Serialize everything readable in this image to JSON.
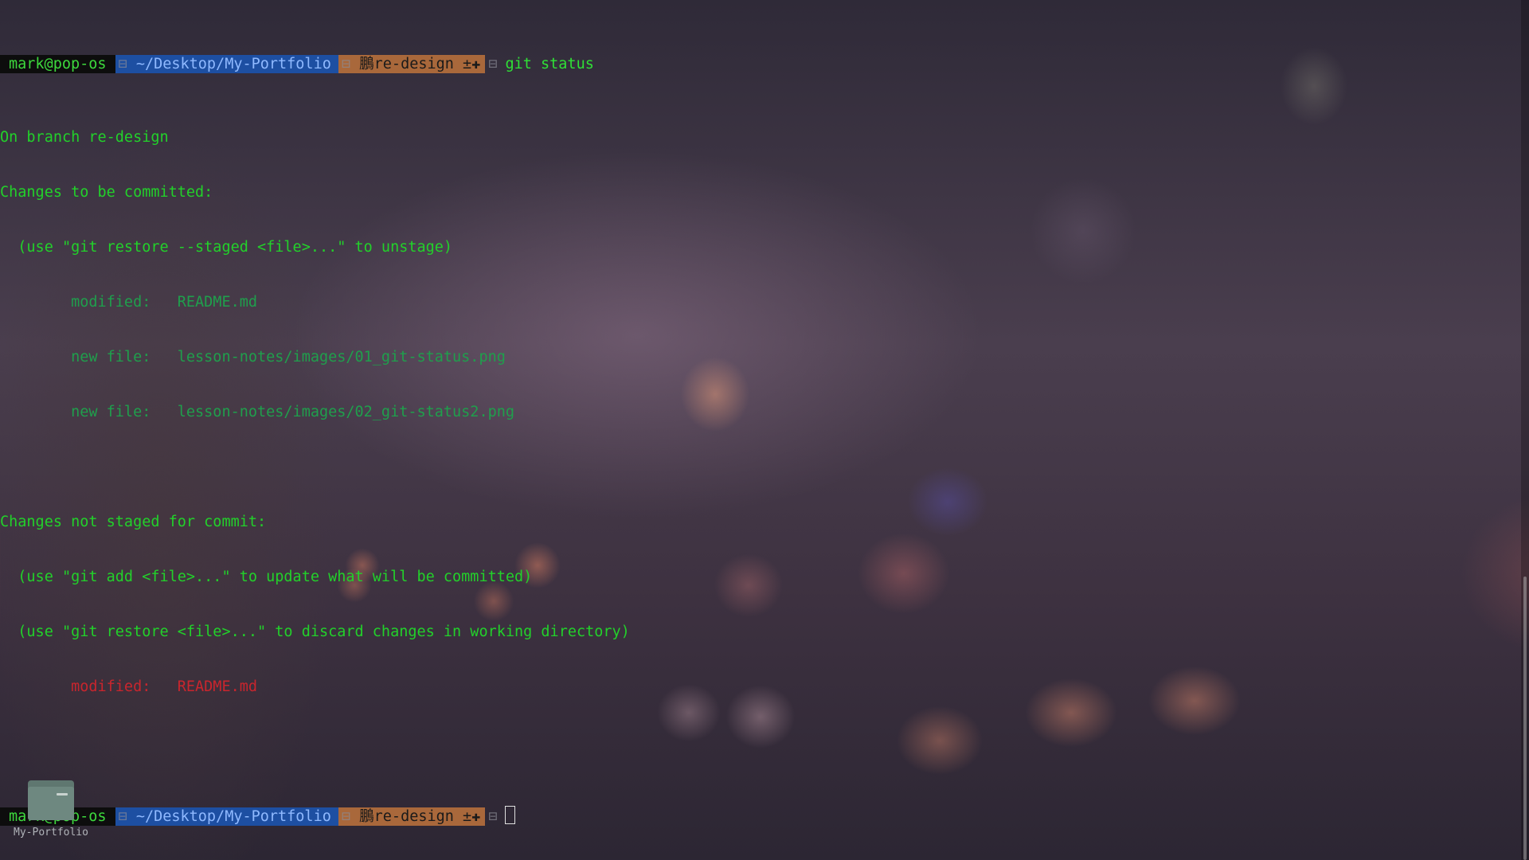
{
  "prompt": {
    "user": "mark@pop-os",
    "path": "~/Desktop/My-Portfolio",
    "branch_icon": "鵬",
    "branch": "re-design",
    "status_marks": "±✚"
  },
  "command": "git status",
  "output": {
    "on_branch": "On branch re-design",
    "staged_header": "Changes to be committed:",
    "staged_hint": "  (use \"git restore --staged <file>...\" to unstage)",
    "staged_files": [
      "        modified:   README.md",
      "        new file:   lesson-notes/images/01_git-status.png",
      "        new file:   lesson-notes/images/02_git-status2.png"
    ],
    "unstaged_header": "Changes not staged for commit:",
    "unstaged_hints": [
      "  (use \"git add <file>...\" to update what will be committed)",
      "  (use \"git restore <file>...\" to discard changes in working directory)"
    ],
    "unstaged_files": [
      "        modified:   README.md"
    ]
  },
  "desktop": {
    "folder_label": "My-Portfolio",
    "folder_icon": "folder-icon"
  },
  "colors": {
    "prompt_green": "#22d12a",
    "path_bg": "#1d4fa2",
    "branch_bg": "#a9683b",
    "staged_file": "#1f9f4c",
    "unstaged_file": "#c9252d"
  }
}
